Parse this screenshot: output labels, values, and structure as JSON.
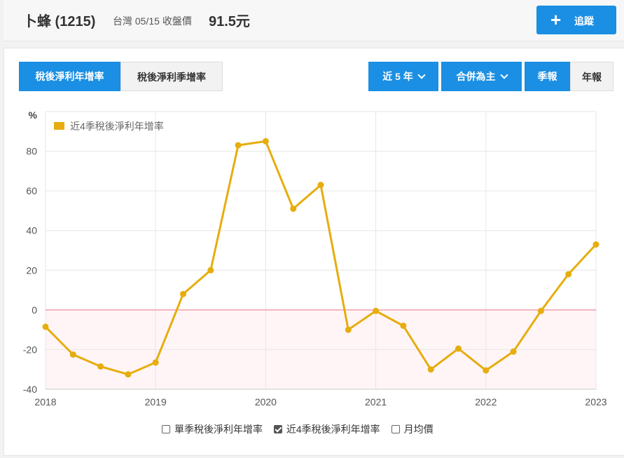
{
  "header": {
    "stock_name": "卜蜂 (1215)",
    "market_date": "台灣 05/15 收盤價",
    "price": "91.5元",
    "track_icon": "plus-icon",
    "track_label": "追蹤"
  },
  "toolbar": {
    "metric_tabs": [
      "稅後淨利年增率",
      "稅後淨利季增率"
    ],
    "range_label": "近 5 年",
    "scope_label": "合併為主",
    "period_tabs": [
      "季報",
      "年報"
    ],
    "colors": {
      "accent": "#1a8fe3"
    }
  },
  "chart_data": {
    "type": "line",
    "ylabel": "%",
    "ylim": [
      -40,
      100
    ],
    "yticks": [
      -40,
      -20,
      0,
      20,
      40,
      60,
      80
    ],
    "xlim": [
      2018,
      2023
    ],
    "xticks": [
      2018,
      2019,
      2020,
      2021,
      2022,
      2023
    ],
    "grid": true,
    "legend_position": "top-left",
    "zero_line_color": "#f0a0a8",
    "negative_fill_color": "#fff5f7",
    "series": [
      {
        "name": "近4季稅後淨利年增率",
        "color": "#e6ad0d",
        "x": [
          2018.0,
          2018.25,
          2018.5,
          2018.75,
          2019.0,
          2019.25,
          2019.5,
          2019.75,
          2020.0,
          2020.25,
          2020.5,
          2020.75,
          2021.0,
          2021.25,
          2021.5,
          2021.75,
          2022.0,
          2022.25,
          2022.5,
          2022.75,
          2023.0
        ],
        "values": [
          -8.5,
          -22.5,
          -28.5,
          -32.5,
          -26.5,
          8,
          20,
          83,
          85,
          51,
          63,
          -10,
          -0.5,
          -8,
          -30,
          -19.5,
          -30.5,
          -21,
          -0.5,
          18,
          33
        ]
      }
    ]
  },
  "bottom_legend": [
    {
      "label": "單季稅後淨利年增率",
      "checked": false
    },
    {
      "label": "近4季稅後淨利年增率",
      "checked": true
    },
    {
      "label": "月均價",
      "checked": false
    }
  ]
}
